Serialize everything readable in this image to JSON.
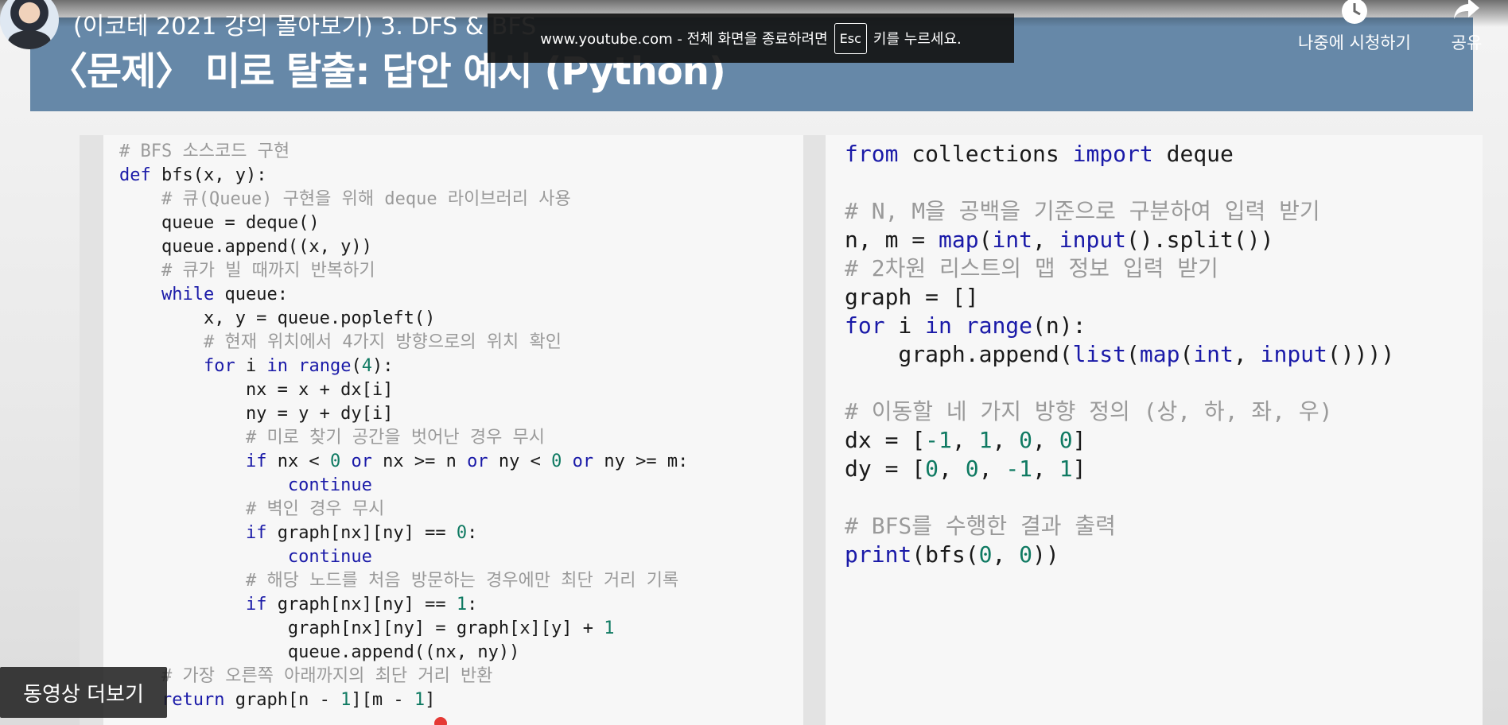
{
  "player": {
    "video_title": "(이코테 2021 강의 몰아보기) 3. DFS & BFS",
    "fullscreen_notice": {
      "prefix": "www.youtube.com - 전체 화면을 종료하려면",
      "key": "Esc",
      "suffix": "키를 누르세요."
    },
    "watch_later_label": "나중에 시청하기",
    "share_label": "공유",
    "more_videos_label": "동영상 더보기",
    "icons": [
      "clock-icon",
      "share-arrow-icon"
    ]
  },
  "slide": {
    "title": "〈문제〉 미로 탈출: 답안 예시 (Python)",
    "header_color": "#6688a8",
    "syntax_colors": {
      "keyword": "#1a1aa8",
      "number": "#0f7a62",
      "comment": "#9a9a9a",
      "text": "#1a1a1a"
    },
    "code_left": [
      [
        [
          "c",
          "# BFS 소스코드 구현"
        ]
      ],
      [
        [
          "k",
          "def"
        ],
        [
          "t",
          " bfs(x, y):"
        ]
      ],
      [
        [
          "t",
          "    "
        ],
        [
          "c",
          "# 큐(Queue) 구현을 위해 deque 라이브러리 사용"
        ]
      ],
      [
        [
          "t",
          "    queue = deque()"
        ]
      ],
      [
        [
          "t",
          "    queue.append((x, y))"
        ]
      ],
      [
        [
          "t",
          "    "
        ],
        [
          "c",
          "# 큐가 빌 때까지 반복하기"
        ]
      ],
      [
        [
          "t",
          "    "
        ],
        [
          "k",
          "while"
        ],
        [
          "t",
          " queue:"
        ]
      ],
      [
        [
          "t",
          "        x, y = queue.popleft()"
        ]
      ],
      [
        [
          "t",
          "        "
        ],
        [
          "c",
          "# 현재 위치에서 4가지 방향으로의 위치 확인"
        ]
      ],
      [
        [
          "t",
          "        "
        ],
        [
          "k",
          "for"
        ],
        [
          "t",
          " i "
        ],
        [
          "k",
          "in"
        ],
        [
          "t",
          " "
        ],
        [
          "k",
          "range"
        ],
        [
          "t",
          "("
        ],
        [
          "n",
          "4"
        ],
        [
          "t",
          "):"
        ]
      ],
      [
        [
          "t",
          "            nx = x + dx[i]"
        ]
      ],
      [
        [
          "t",
          "            ny = y + dy[i]"
        ]
      ],
      [
        [
          "t",
          "            "
        ],
        [
          "c",
          "# 미로 찾기 공간을 벗어난 경우 무시"
        ]
      ],
      [
        [
          "t",
          "            "
        ],
        [
          "k",
          "if"
        ],
        [
          "t",
          " nx < "
        ],
        [
          "n",
          "0"
        ],
        [
          "t",
          " "
        ],
        [
          "k",
          "or"
        ],
        [
          "t",
          " nx >= n "
        ],
        [
          "k",
          "or"
        ],
        [
          "t",
          " ny < "
        ],
        [
          "n",
          "0"
        ],
        [
          "t",
          " "
        ],
        [
          "k",
          "or"
        ],
        [
          "t",
          " ny >= m:"
        ]
      ],
      [
        [
          "t",
          "                "
        ],
        [
          "k",
          "continue"
        ]
      ],
      [
        [
          "t",
          "            "
        ],
        [
          "c",
          "# 벽인 경우 무시"
        ]
      ],
      [
        [
          "t",
          "            "
        ],
        [
          "k",
          "if"
        ],
        [
          "t",
          " graph[nx][ny] == "
        ],
        [
          "n",
          "0"
        ],
        [
          "t",
          ":"
        ]
      ],
      [
        [
          "t",
          "                "
        ],
        [
          "k",
          "continue"
        ]
      ],
      [
        [
          "t",
          "            "
        ],
        [
          "c",
          "# 해당 노드를 처음 방문하는 경우에만 최단 거리 기록"
        ]
      ],
      [
        [
          "t",
          "            "
        ],
        [
          "k",
          "if"
        ],
        [
          "t",
          " graph[nx][ny] == "
        ],
        [
          "n",
          "1"
        ],
        [
          "t",
          ":"
        ]
      ],
      [
        [
          "t",
          "                graph[nx][ny] = graph[x][y] + "
        ],
        [
          "n",
          "1"
        ]
      ],
      [
        [
          "t",
          "                queue.append((nx, ny))"
        ]
      ],
      [
        [
          "t",
          "    "
        ],
        [
          "c",
          "# 가장 오른쪽 아래까지의 최단 거리 반환"
        ]
      ],
      [
        [
          "t",
          "    "
        ],
        [
          "k",
          "return"
        ],
        [
          "t",
          " graph[n - "
        ],
        [
          "n",
          "1"
        ],
        [
          "t",
          "][m - "
        ],
        [
          "n",
          "1"
        ],
        [
          "t",
          "]"
        ]
      ]
    ],
    "code_right": [
      [
        [
          "k",
          "from"
        ],
        [
          "t",
          " collections "
        ],
        [
          "k",
          "import"
        ],
        [
          "t",
          " deque"
        ]
      ],
      [],
      [
        [
          "c",
          "# N, M을 공백을 기준으로 구분하여 입력 받기"
        ]
      ],
      [
        [
          "t",
          "n, m = "
        ],
        [
          "k",
          "map"
        ],
        [
          "t",
          "("
        ],
        [
          "k",
          "int"
        ],
        [
          "t",
          ", "
        ],
        [
          "k",
          "input"
        ],
        [
          "t",
          "().split())"
        ]
      ],
      [
        [
          "c",
          "# 2차원 리스트의 맵 정보 입력 받기"
        ]
      ],
      [
        [
          "t",
          "graph = []"
        ]
      ],
      [
        [
          "k",
          "for"
        ],
        [
          "t",
          " i "
        ],
        [
          "k",
          "in"
        ],
        [
          "t",
          " "
        ],
        [
          "k",
          "range"
        ],
        [
          "t",
          "(n):"
        ]
      ],
      [
        [
          "t",
          "    graph.append("
        ],
        [
          "k",
          "list"
        ],
        [
          "t",
          "("
        ],
        [
          "k",
          "map"
        ],
        [
          "t",
          "("
        ],
        [
          "k",
          "int"
        ],
        [
          "t",
          ", "
        ],
        [
          "k",
          "input"
        ],
        [
          "t",
          "())))"
        ]
      ],
      [],
      [
        [
          "c",
          "# 이동할 네 가지 방향 정의 (상, 하, 좌, 우)"
        ]
      ],
      [
        [
          "t",
          "dx = ["
        ],
        [
          "n",
          "-1"
        ],
        [
          "t",
          ", "
        ],
        [
          "n",
          "1"
        ],
        [
          "t",
          ", "
        ],
        [
          "n",
          "0"
        ],
        [
          "t",
          ", "
        ],
        [
          "n",
          "0"
        ],
        [
          "t",
          "]"
        ]
      ],
      [
        [
          "t",
          "dy = ["
        ],
        [
          "n",
          "0"
        ],
        [
          "t",
          ", "
        ],
        [
          "n",
          "0"
        ],
        [
          "t",
          ", "
        ],
        [
          "n",
          "-1"
        ],
        [
          "t",
          ", "
        ],
        [
          "n",
          "1"
        ],
        [
          "t",
          "]"
        ]
      ],
      [],
      [
        [
          "c",
          "# BFS를 수행한 결과 출력"
        ]
      ],
      [
        [
          "k",
          "print"
        ],
        [
          "t",
          "(bfs("
        ],
        [
          "n",
          "0"
        ],
        [
          "t",
          ", "
        ],
        [
          "n",
          "0"
        ],
        [
          "t",
          "))"
        ]
      ]
    ]
  }
}
